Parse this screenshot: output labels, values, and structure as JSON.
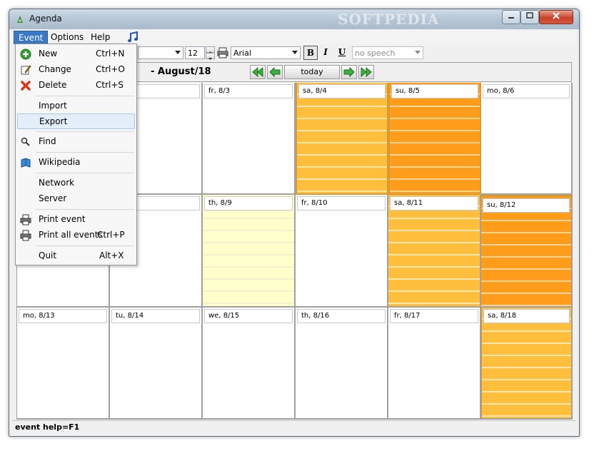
{
  "window": {
    "title": "Agenda"
  },
  "watermark": "SOFTPEDIA",
  "menubar": {
    "items": [
      "Event",
      "Options",
      "Help"
    ]
  },
  "toolbar": {
    "font_size": "12",
    "font_name": "Arial",
    "speech": "no speech",
    "bold": "B",
    "italic": "I",
    "underline": "U"
  },
  "nav": {
    "month_label": "- August/18",
    "today": "today"
  },
  "event_menu": {
    "new": {
      "label": "New",
      "shortcut": "Ctrl+N"
    },
    "change": {
      "label": "Change",
      "shortcut": "Ctrl+O"
    },
    "delete": {
      "label": "Delete",
      "shortcut": "Ctrl+S"
    },
    "import": {
      "label": "Import"
    },
    "export": {
      "label": "Export"
    },
    "find": {
      "label": "Find"
    },
    "wikipedia": {
      "label": "Wikipedia"
    },
    "network": {
      "label": "Network"
    },
    "server": {
      "label": "Server"
    },
    "print_event": {
      "label": "Print event"
    },
    "print_all": {
      "label": "Print all events",
      "shortcut": "Ctrl+P"
    },
    "quit": {
      "label": "Quit",
      "shortcut": "Alt+X"
    }
  },
  "calendar": {
    "colors": {
      "light_orange": "#ffbf3c",
      "dark_orange": "#ff9d1a",
      "pale_yellow": "#ffffcc"
    },
    "weeks": [
      [
        "",
        "",
        "fr, 8/3",
        "sa, 8/4",
        "su, 8/5",
        "mo, 8/6"
      ],
      [
        "",
        "",
        "th, 8/9",
        "fr, 8/10",
        "sa, 8/11",
        "su, 8/12"
      ],
      [
        "mo, 8/13",
        "tu, 8/14",
        "we, 8/15",
        "th, 8/16",
        "fr, 8/17",
        "sa, 8/18"
      ]
    ]
  },
  "status": {
    "text": "event help=F1"
  }
}
